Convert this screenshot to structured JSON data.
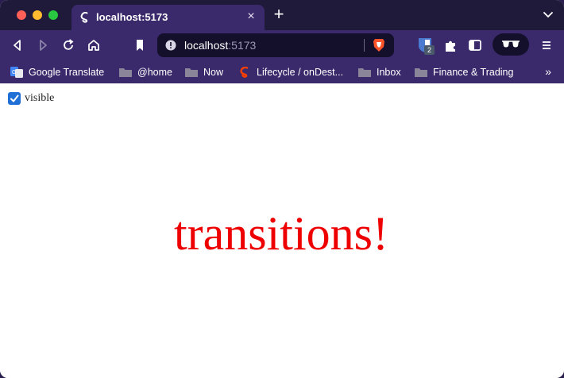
{
  "browser": {
    "tab": {
      "title": "localhost:5173",
      "favicon": "svelte-icon"
    },
    "address": {
      "host": "localhost",
      "port": ":5173"
    },
    "extension_badge": "2",
    "bookmarks": [
      {
        "label": "Google Translate",
        "icon": "google-translate-icon"
      },
      {
        "label": "@home",
        "icon": "folder-icon"
      },
      {
        "label": "Now",
        "icon": "folder-icon"
      },
      {
        "label": "Lifecycle / onDest...",
        "icon": "svelte-icon"
      },
      {
        "label": "Inbox",
        "icon": "folder-icon"
      },
      {
        "label": "Finance & Trading",
        "icon": "folder-icon"
      }
    ],
    "colors": {
      "chrome": "#3a2a6b",
      "tabstrip": "#1f1a3a",
      "url_bar": "#140f2a"
    }
  },
  "page": {
    "checkbox": {
      "label": "visible",
      "checked": true
    },
    "headline": "transitions!",
    "headline_color": "#ee0000"
  }
}
